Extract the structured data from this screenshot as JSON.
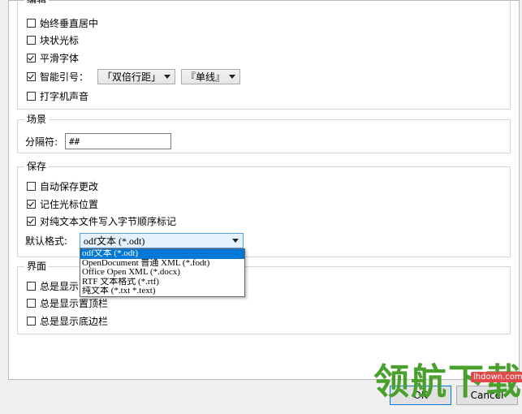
{
  "editing": {
    "title": "编辑",
    "options": [
      {
        "label": "始终垂直居中",
        "checked": false
      },
      {
        "label": "块状光标",
        "checked": false
      },
      {
        "label": "平滑字体",
        "checked": true
      },
      {
        "label": "智能引号：",
        "checked": true
      },
      {
        "label": "打字机声音",
        "checked": false
      }
    ],
    "quote_double": "「双倍行距」",
    "quote_single": "『单线』"
  },
  "scene": {
    "title": "场景",
    "separator_label": "分隔符:",
    "separator_value": "##"
  },
  "save": {
    "title": "保存",
    "options": [
      {
        "label": "自动保存更改",
        "checked": false
      },
      {
        "label": "记住光标位置",
        "checked": true
      },
      {
        "label": "对纯文本文件写入字节顺序标记",
        "checked": true
      }
    ],
    "default_format_label": "默认格式:",
    "default_format_value": "odf文本 (*.odt)",
    "format_options": [
      "odf文本 (*.odt)",
      "OpenDocument 普通 XML (*.fodt)",
      "Office Open XML (*.docx)",
      "RTF 文本格式 (*.rtf)",
      "纯文本 (*.txt *.text)"
    ]
  },
  "interface": {
    "title": "界面",
    "options": [
      {
        "label": "总是显示",
        "checked": false
      },
      {
        "label": "总是显示置顶栏",
        "checked": false
      },
      {
        "label": "总是显示底边栏",
        "checked": false
      }
    ]
  },
  "buttons": {
    "ok": "OK",
    "cancel": "Cancel"
  },
  "watermark": {
    "text": "领航下载",
    "url": "lhdown.com"
  }
}
